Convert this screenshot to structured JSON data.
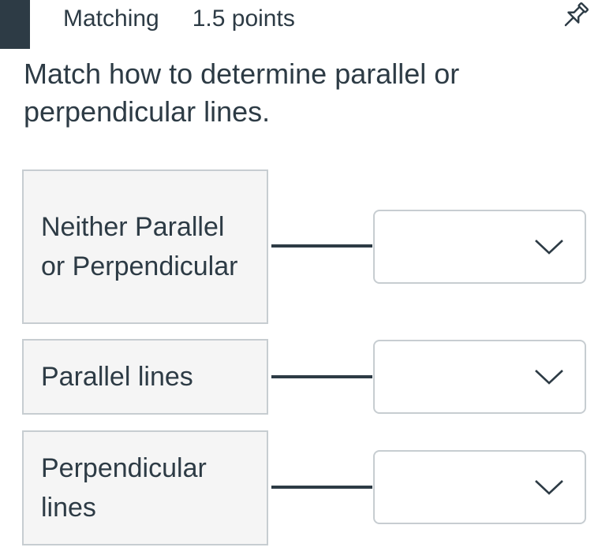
{
  "header": {
    "question_type": "Matching",
    "points": "1.5 points",
    "pin_icon": "pin-icon"
  },
  "question": {
    "prompt": "Match how to determine parallel or perpendicular lines."
  },
  "pairs": [
    {
      "answer": "Neither Parallel or Perpendicular",
      "selected": ""
    },
    {
      "answer": "Parallel lines",
      "selected": ""
    },
    {
      "answer": "Perpendicular lines",
      "selected": ""
    }
  ],
  "colors": {
    "text": "#2d3b45",
    "box_bg": "#f5f5f5",
    "border": "#c7cdd1"
  }
}
